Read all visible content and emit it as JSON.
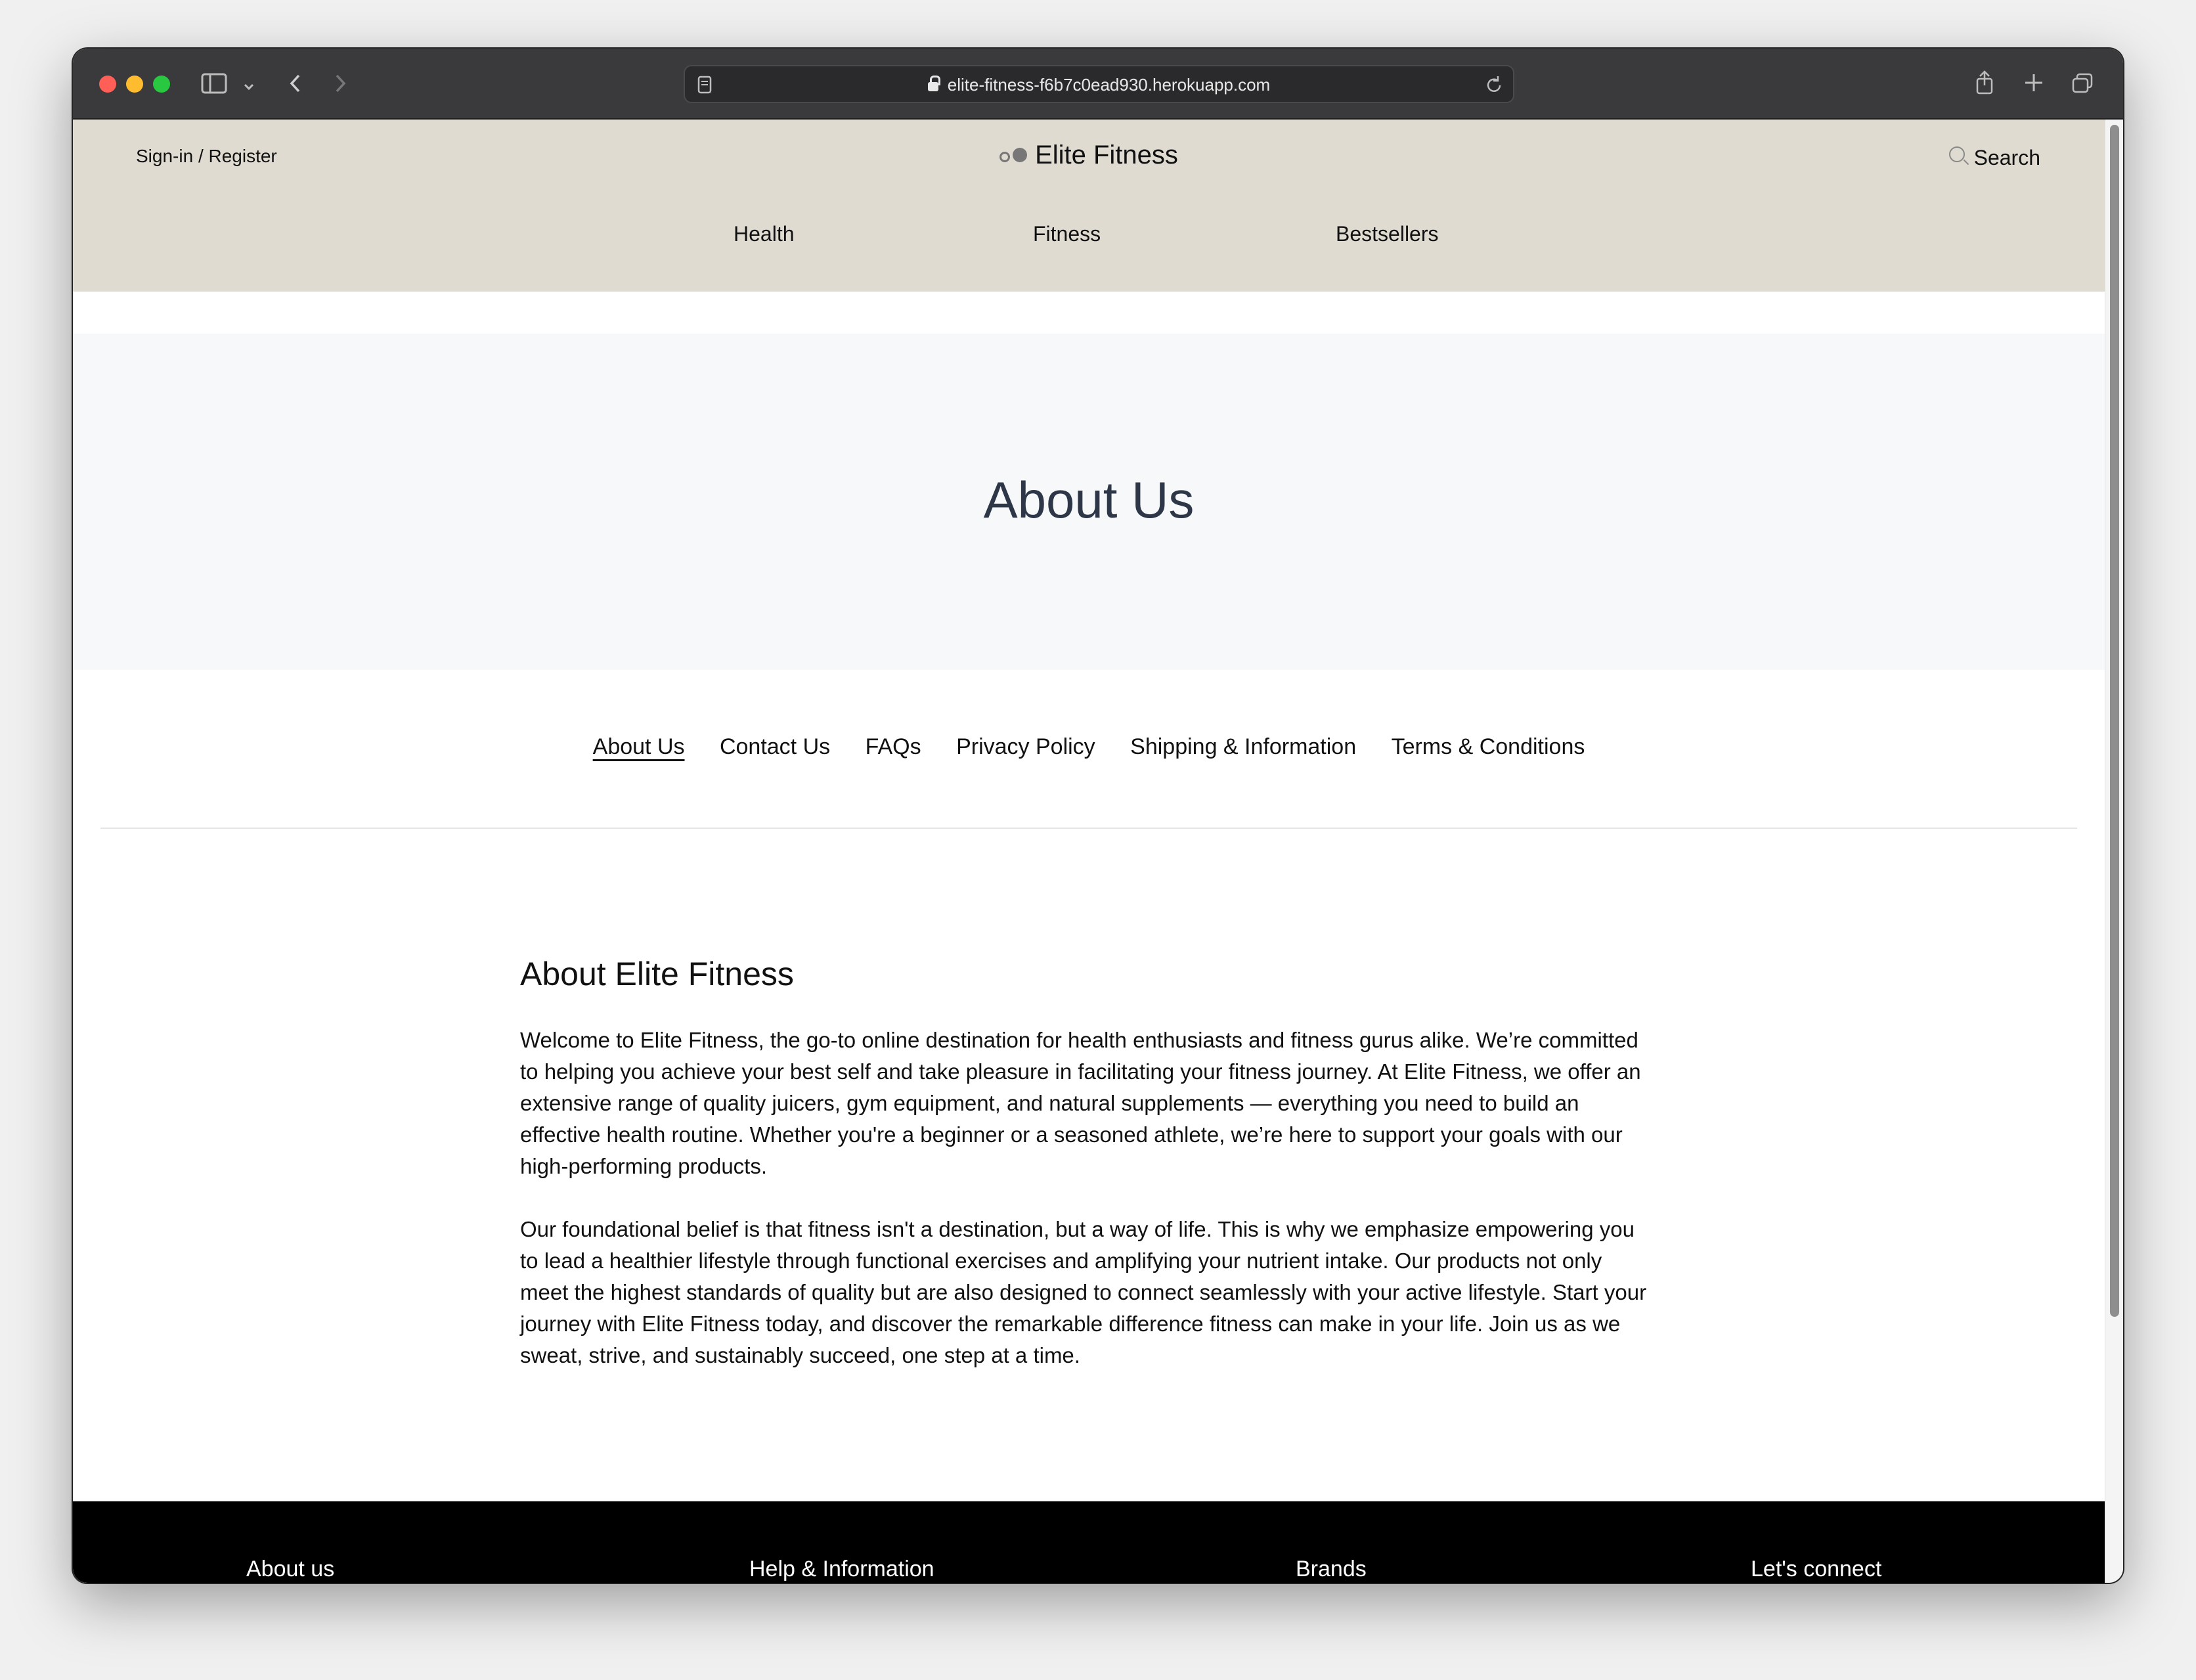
{
  "browser": {
    "url": "elite-fitness-f6b7c0ead930.herokuapp.com"
  },
  "header": {
    "signin": "Sign-in / Register",
    "brand": "Elite Fitness",
    "search": "Search",
    "nav": [
      "Health",
      "Fitness",
      "Bestsellers"
    ]
  },
  "hero": {
    "title": "About Us"
  },
  "subnav": [
    "About Us",
    "Contact Us",
    "FAQs",
    "Privacy Policy",
    "Shipping & Information",
    "Terms & Conditions"
  ],
  "content": {
    "heading": "About Elite Fitness",
    "paragraphs": [
      "Welcome to Elite Fitness, the go-to online destination for health enthusiasts and fitness gurus alike. We’re committed to helping you achieve your best self and take pleasure in facilitating your fitness journey. At Elite Fitness, we offer an extensive range of quality juicers, gym equipment, and natural supplements — everything you need to build an effective health routine. Whether you're a beginner or a seasoned athlete, we’re here to support your goals with our high-performing products.",
      "Our foundational belief is that fitness isn't a destination, but a way of life. This is why we emphasize empowering you to lead a healthier lifestyle through functional exercises and amplifying your nutrient intake. Our products not only meet the highest standards of quality but are also designed to connect seamlessly with your active lifestyle. Start your journey with Elite Fitness today, and discover the remarkable difference fitness can make in your life. Join us as we sweat, strive, and sustainably succeed, one step at a time."
    ]
  },
  "footer": {
    "headings": [
      "About us",
      "Help & Information",
      "Brands",
      "Let's connect"
    ]
  }
}
